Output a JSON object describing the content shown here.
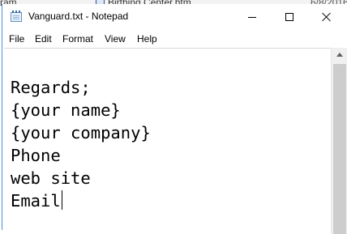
{
  "background": {
    "left_text": "ram",
    "file_name": "Birthing Center.htm",
    "file_date": "6/8/2016"
  },
  "window": {
    "title": "Vanguard.txt - Notepad",
    "buttons": {
      "minimize": "minimize",
      "maximize": "maximize",
      "close": "close"
    }
  },
  "menu": {
    "file": "File",
    "edit": "Edit",
    "format": "Format",
    "view": "View",
    "help": "Help"
  },
  "document": {
    "lines": [
      "Regards;",
      "{your name}",
      "{your company}",
      "Phone",
      "web site",
      "Email"
    ]
  },
  "icons": {
    "app": "notepad-icon",
    "doc": "word-doc-icon",
    "scroll_up": "arrow-up-icon"
  },
  "colors": {
    "window_border": "#4a90d9",
    "scrollbar_track": "#f0f0f0",
    "scrollbar_thumb": "#cdcdcd"
  }
}
